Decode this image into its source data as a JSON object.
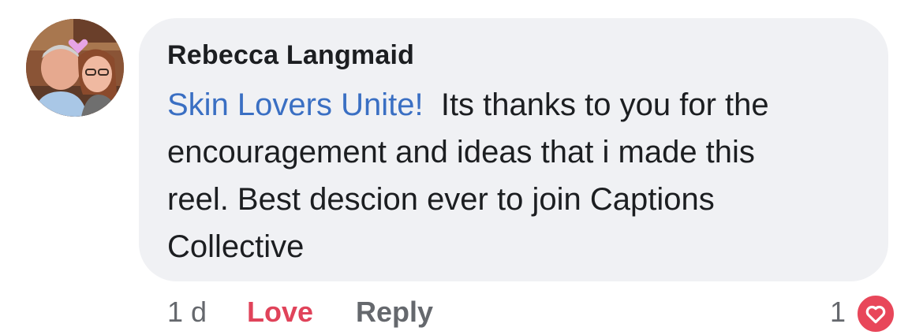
{
  "comment": {
    "author": "Rebecca Langmaid",
    "avatar_icon": "profile-photo-icon",
    "mention": "Skin Lovers Unite!",
    "body_lines": [
      "Its thanks to you for the",
      "encouragement and ideas that i made this",
      "reel. Best descion ever to join Captions",
      "Collective"
    ],
    "mention_color": "#3a6fc3",
    "bubble_color": "#f0f1f4"
  },
  "actions": {
    "time": "1 d",
    "love_label": "Love",
    "love_color": "#e0435a",
    "reply_label": "Reply"
  },
  "reactions": {
    "count": "1",
    "icon": "heart-icon",
    "badge_color": "#e8475a"
  }
}
